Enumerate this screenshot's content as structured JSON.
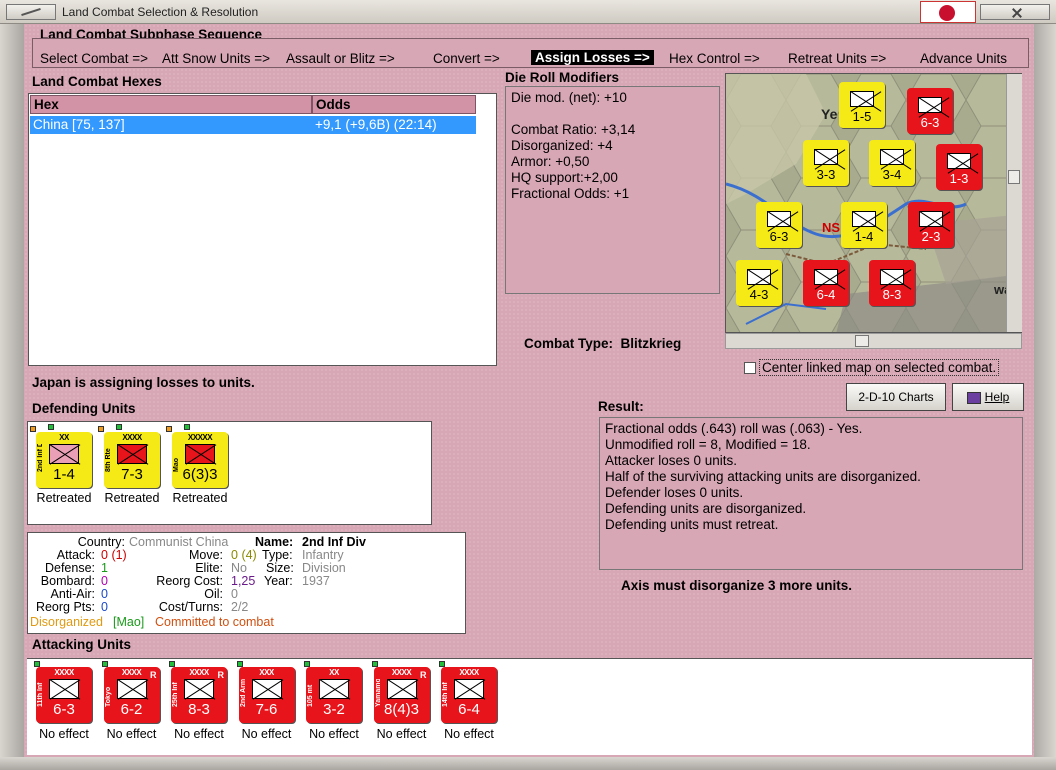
{
  "window": {
    "title": "Land Combat Selection & Resolution"
  },
  "subphase": {
    "heading": "Land Combat Subphase Sequence",
    "steps": [
      "Select Combat =>",
      "Att Snow Units =>",
      "Assault or Blitz =>",
      "Convert =>",
      "Assign Losses =>",
      "Hex Control =>",
      "Retreat Units =>",
      "Advance Units"
    ],
    "active_index": 4
  },
  "combat_hexes": {
    "heading": "Land Combat Hexes",
    "columns": [
      "Hex",
      "Odds"
    ],
    "rows": [
      {
        "hex": "China [75, 137]",
        "odds": "+9,1 (+9,6B) (22:14)"
      }
    ]
  },
  "die_roll": {
    "heading": "Die Roll Modifiers",
    "lines": [
      "Die mod. (net): +10",
      "",
      "Combat Ratio: +3,14",
      "Disorganized: +4",
      "Armor: +0,50",
      "HQ support:+2,00",
      "Fractional Odds: +1"
    ]
  },
  "combat_type": {
    "label": "Combat Type:",
    "value": "Blitzkrieg"
  },
  "center_map": {
    "label": "Center linked map on selected combat.",
    "checked": false
  },
  "buttons": {
    "charts": "2-D-10 Charts",
    "help": "Help"
  },
  "status_message": "Japan is assigning losses to units.",
  "result": {
    "heading": "Result:",
    "lines": [
      "Fractional odds (.643) roll was (.063)  - Yes.",
      "Unmodified roll = 8, Modified = 18.",
      "Attacker loses 0 units.",
      "Half of the surviving attacking units are disorganized.",
      "Defender loses 0 units.",
      "Defending units are disorganized.",
      "Defending units must retreat."
    ]
  },
  "axis_message": "Axis must disorganize 3 more units.",
  "defending": {
    "heading": "Defending Units",
    "units": [
      {
        "size": "XX",
        "name": "2nd Inf Div",
        "strength": "1-4",
        "status": "Retreated",
        "fill": "pink"
      },
      {
        "size": "XXXX",
        "name": "8th Rte",
        "strength": "7-3",
        "status": "Retreated",
        "fill": "red"
      },
      {
        "size": "XXXXX",
        "name": "Mao",
        "strength": "6(3)3",
        "status": "Retreated",
        "fill": "red"
      }
    ]
  },
  "info": {
    "country_label": "Country:",
    "country": "Communist China",
    "name_label": "Name:",
    "name": "2nd Inf Div",
    "attack_label": "Attack:",
    "attack": "0",
    "attack_paren": "(1)",
    "move_label": "Move:",
    "move": "0",
    "move_paren": "(4)",
    "type_label": "Type:",
    "type": "Infantry",
    "defense_label": "Defense:",
    "defense": "1",
    "elite_label": "Elite:",
    "elite": "No",
    "size_label": "Size:",
    "size": "Division",
    "bombard_label": "Bombard:",
    "bombard": "0",
    "reorg_cost_label": "Reorg Cost:",
    "reorg_cost": "1,25",
    "year_label": "Year:",
    "year": "1937",
    "antiair_label": "Anti-Air:",
    "antiair": "0",
    "oil_label": "Oil:",
    "oil": "0",
    "reorg_pts_label": "Reorg Pts:",
    "reorg_pts": "0",
    "cost_turns_label": "Cost/Turns:",
    "cost_turns": "2/2",
    "disorganized": "Disorganized",
    "mao_tag": "[Mao]",
    "committed": "Committed to combat"
  },
  "attacking": {
    "heading": "Attacking Units",
    "units": [
      {
        "size": "XXXX",
        "name": "11th Inf",
        "strength": "6-3",
        "status": "No effect",
        "r": ""
      },
      {
        "size": "XXXX",
        "name": "Tokyo",
        "strength": "6-2",
        "status": "No effect",
        "r": "R"
      },
      {
        "size": "XXXX",
        "name": "25th Inf",
        "strength": "8-3",
        "status": "No effect",
        "r": "R"
      },
      {
        "size": "XXX",
        "name": "2nd Arm",
        "strength": "7-6",
        "status": "No effect",
        "r": ""
      },
      {
        "size": "XX",
        "name": "105 mt",
        "strength": "3-2",
        "status": "No effect",
        "r": ""
      },
      {
        "size": "XXXX",
        "name": "Yamamoto",
        "strength": "8(4)3",
        "status": "No effect",
        "r": "R"
      },
      {
        "size": "XXXX",
        "name": "14th Inf",
        "strength": "6-4",
        "status": "No effect",
        "r": ""
      }
    ]
  },
  "map": {
    "label_text": [
      "Ye",
      "NS",
      "wa"
    ],
    "counters": [
      {
        "strength": "1-5",
        "color": "yellow"
      },
      {
        "strength": "6-3",
        "color": "red"
      },
      {
        "strength": "3-3",
        "color": "yellow"
      },
      {
        "strength": "3-4",
        "color": "yellow"
      },
      {
        "strength": "1-3",
        "color": "red"
      },
      {
        "strength": "6-3",
        "color": "yellow"
      },
      {
        "strength": "1-4",
        "color": "yellow"
      },
      {
        "strength": "2-3",
        "color": "red"
      },
      {
        "strength": "4-3",
        "color": "yellow"
      },
      {
        "strength": "6-4",
        "color": "red"
      },
      {
        "strength": "8-3",
        "color": "red"
      }
    ]
  }
}
